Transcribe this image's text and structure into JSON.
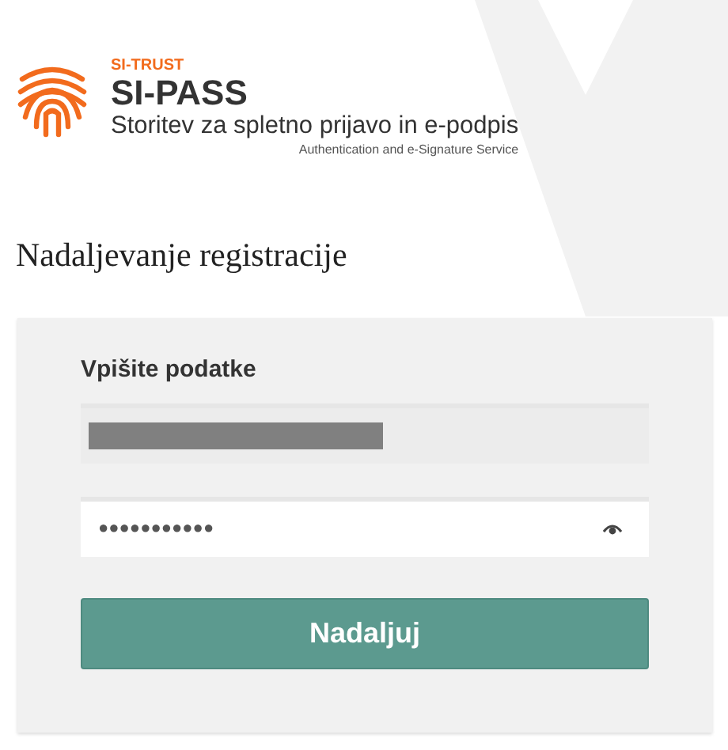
{
  "header": {
    "brand_label": "SI-TRUST",
    "product": "SI-PASS",
    "subtitle": "Storitev za spletno prijavo in e-podpis",
    "tagline": "Authentication and e-Signature Service"
  },
  "page_title": "Nadaljevanje registracije",
  "form": {
    "heading": "Vpišite podatke",
    "fields": [
      {
        "kind": "text",
        "redacted": true,
        "disabled": true
      },
      {
        "kind": "password",
        "value": "●●●●●●●●●●●",
        "disabled": false
      }
    ],
    "submit": "Nadaljuj"
  }
}
